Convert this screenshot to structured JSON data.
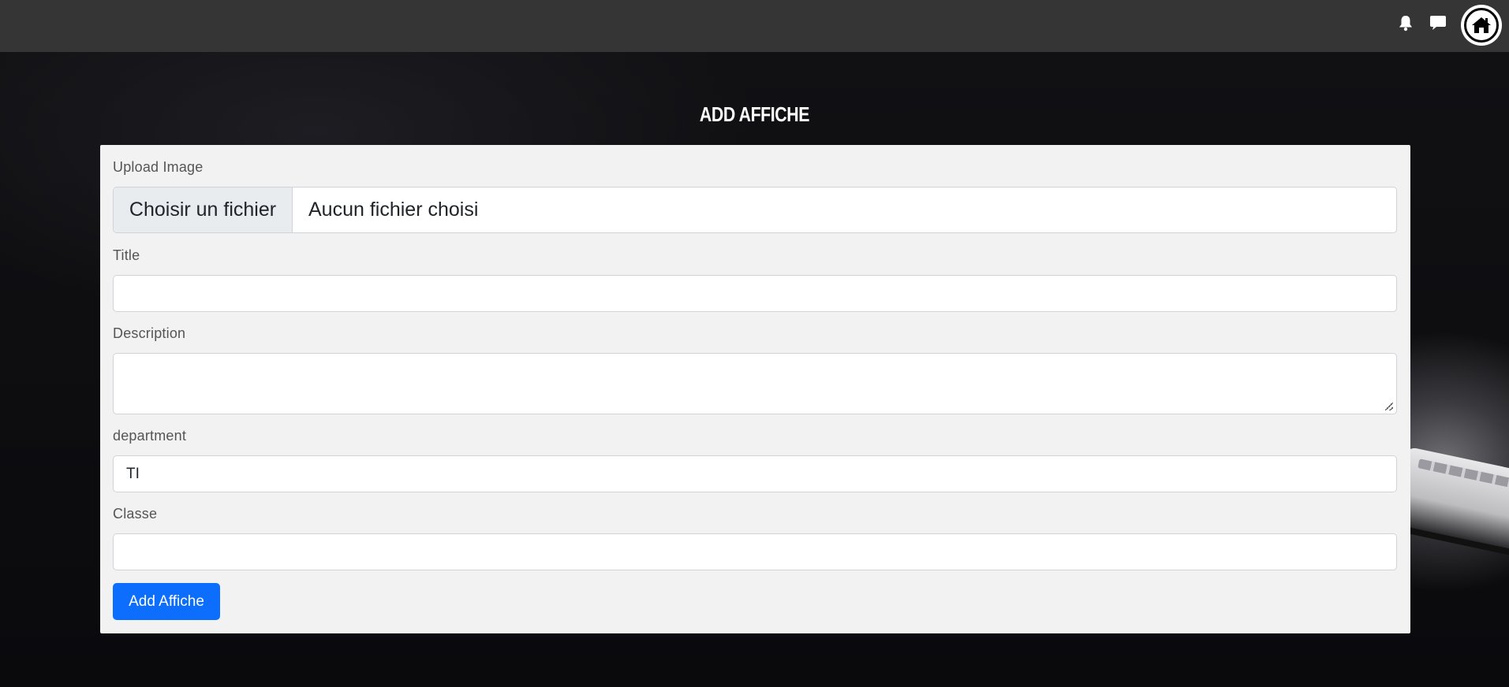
{
  "header": {
    "icons": [
      "bell-icon",
      "chat-icon",
      "home-icon"
    ]
  },
  "page": {
    "title": "ADD AFFICHE"
  },
  "form": {
    "upload": {
      "label": "Upload Image",
      "button_label": "Choisir un fichier",
      "file_status": "Aucun fichier choisi"
    },
    "title": {
      "label": "Title",
      "value": ""
    },
    "description": {
      "label": "Description",
      "value": ""
    },
    "department": {
      "label": "department",
      "value": "TI"
    },
    "classe": {
      "label": "Classe",
      "value": ""
    },
    "submit_label": "Add Affiche"
  },
  "colors": {
    "topbar": "#353535",
    "card": "#f2f2f2",
    "primary_button": "#0d6efd"
  }
}
